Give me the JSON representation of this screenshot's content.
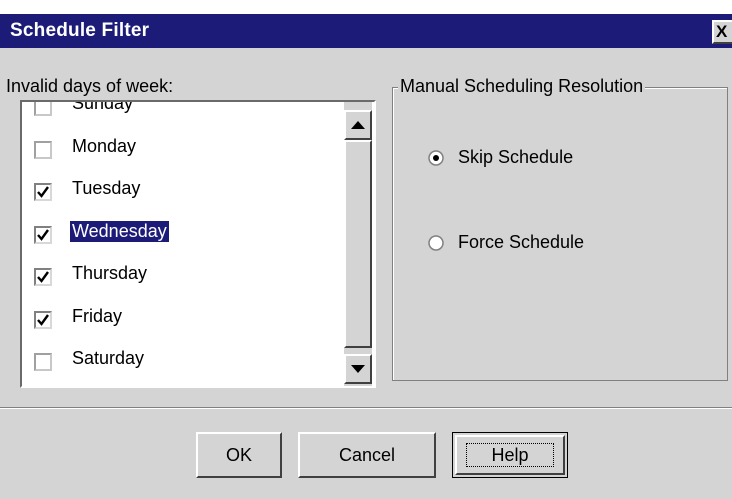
{
  "dialog": {
    "title": "Schedule Filter",
    "close_glyph": "X"
  },
  "days": {
    "label": "Invalid days of week:",
    "items": [
      {
        "label": "Sunday",
        "checked": false,
        "selected": false
      },
      {
        "label": "Monday",
        "checked": false,
        "selected": false
      },
      {
        "label": "Tuesday",
        "checked": true,
        "selected": false
      },
      {
        "label": "Wednesday",
        "checked": true,
        "selected": true
      },
      {
        "label": "Thursday",
        "checked": true,
        "selected": false
      },
      {
        "label": "Friday",
        "checked": true,
        "selected": false
      },
      {
        "label": "Saturday",
        "checked": false,
        "selected": false
      }
    ]
  },
  "resolution": {
    "legend": "Manual Scheduling Resolution",
    "options": [
      {
        "label": "Skip Schedule",
        "selected": true
      },
      {
        "label": "Force Schedule",
        "selected": false
      }
    ]
  },
  "buttons": {
    "ok": "OK",
    "cancel": "Cancel",
    "help": "Help"
  },
  "colors": {
    "titlebar": "#1c1c78",
    "selection": "#1c1c78",
    "face": "#d4d4d4"
  }
}
